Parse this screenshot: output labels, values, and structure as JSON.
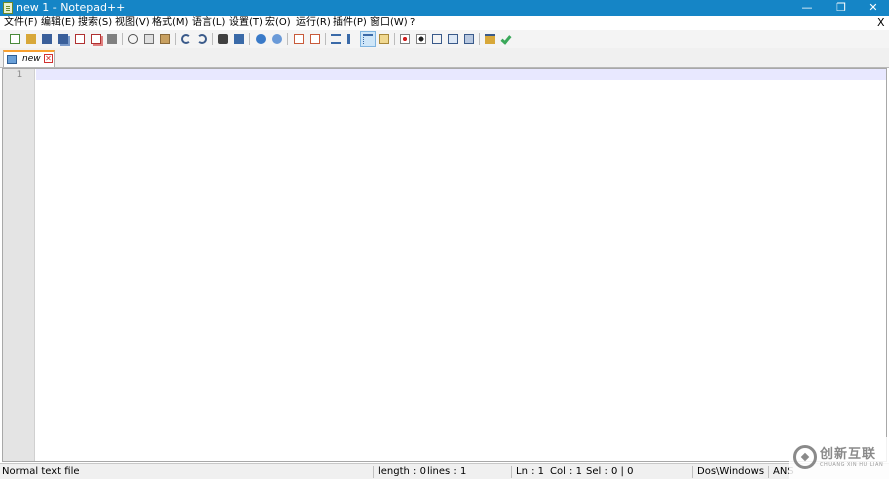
{
  "window": {
    "title": "new  1 - Notepad++",
    "minimize_glyph": "—",
    "maximize_glyph": "❐",
    "close_glyph": "✕"
  },
  "menubar": {
    "items": [
      {
        "label": "文件(F)"
      },
      {
        "label": "编辑(E)"
      },
      {
        "label": "搜索(S)"
      },
      {
        "label": "视图(V)"
      },
      {
        "label": "格式(M)"
      },
      {
        "label": "语言(L)"
      },
      {
        "label": "设置(T)"
      },
      {
        "label": "宏(O)"
      },
      {
        "label": "运行(R)"
      },
      {
        "label": "插件(P)"
      },
      {
        "label": "窗口(W)"
      },
      {
        "label": "?"
      }
    ],
    "close_glyph": "X"
  },
  "toolbar": {
    "buttons": [
      {
        "icon": "new-file-icon",
        "color": "#4a8a3a"
      },
      {
        "icon": "open-file-icon",
        "color": "#d8a83a"
      },
      {
        "icon": "save-icon",
        "color": "#3a5f9a"
      },
      {
        "icon": "save-all-icon",
        "color": "#3a5f9a"
      },
      {
        "icon": "close-icon",
        "color": "#b03030"
      },
      {
        "icon": "close-all-icon",
        "color": "#b03030"
      },
      {
        "icon": "print-icon",
        "color": "#606060"
      },
      {
        "icon": "cut-icon",
        "color": "#505050"
      },
      {
        "icon": "copy-icon",
        "color": "#707070"
      },
      {
        "icon": "paste-icon",
        "color": "#8a6a3a"
      },
      {
        "icon": "undo-icon",
        "color": "#3a5a8a"
      },
      {
        "icon": "redo-icon",
        "color": "#3a5a8a"
      },
      {
        "icon": "find-icon",
        "color": "#404040"
      },
      {
        "icon": "replace-icon",
        "color": "#3a6aa8"
      },
      {
        "icon": "zoom-in-icon",
        "color": "#3a7ac8"
      },
      {
        "icon": "zoom-out-icon",
        "color": "#3a7ac8"
      },
      {
        "icon": "sync-vertical-icon",
        "color": "#c85a3a"
      },
      {
        "icon": "sync-horizontal-icon",
        "color": "#c85a3a"
      },
      {
        "icon": "word-wrap-icon",
        "color": "#3a6aa8"
      },
      {
        "icon": "show-all-chars-icon",
        "color": "#3a6aa8"
      },
      {
        "icon": "indent-guide-icon",
        "color": "#3a6aa8"
      },
      {
        "icon": "document-map-icon",
        "color": "#d8a83a"
      },
      {
        "icon": "record-macro-icon",
        "color": "#d02020"
      },
      {
        "icon": "stop-recording-icon",
        "color": "#202020"
      },
      {
        "icon": "play-macro-icon",
        "color": "#3a5a8a"
      },
      {
        "icon": "run-macro-multiple-icon",
        "color": "#3a5a8a"
      },
      {
        "icon": "save-macro-icon",
        "color": "#3a5a8a"
      },
      {
        "icon": "folder-as-workspace-icon",
        "color": "#d8a83a"
      },
      {
        "icon": "spell-check-icon",
        "color": "#3aa85a"
      }
    ]
  },
  "tabs": [
    {
      "label": "new",
      "close_glyph": "✕"
    }
  ],
  "editor": {
    "line_numbers": [
      "1"
    ]
  },
  "statusbar": {
    "file_type": "Normal text file",
    "length": "length : 0",
    "lines": "lines : 1",
    "ln": "Ln : 1",
    "col": "Col : 1",
    "sel": "Sel : 0 | 0",
    "eol": "Dos\\Windows",
    "encoding": "ANS"
  },
  "watermark": {
    "text": "创新互联",
    "subtext": "CHUANG XIN HU LIAN"
  }
}
